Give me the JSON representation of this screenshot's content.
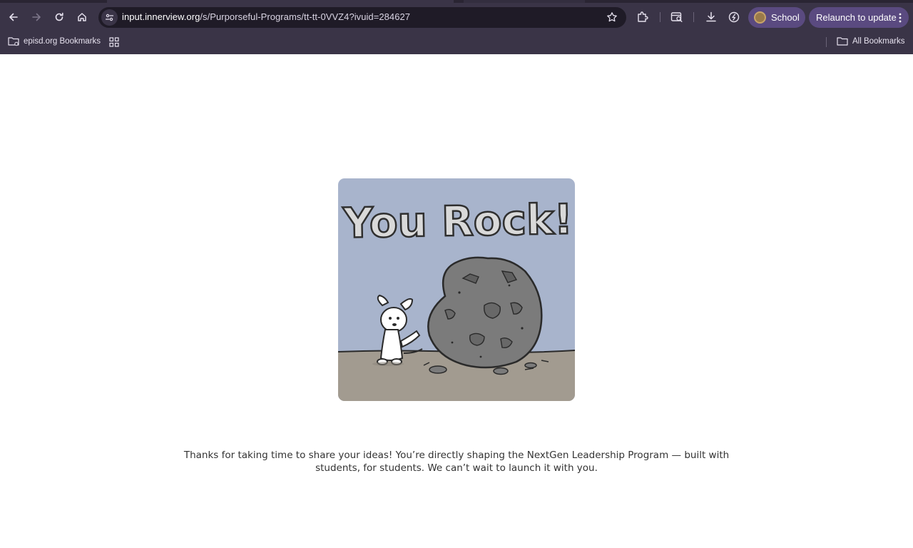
{
  "browser": {
    "url_host": "input.innerview.org",
    "url_path": "/s/Purporseful-Programs/tt-tt-0VVZ4?ivuid=284627",
    "profile_name": "School",
    "relaunch_label": "Relaunch to update"
  },
  "bookmarks": {
    "folder_label": "episd.org Bookmarks",
    "all_label": "All Bookmarks"
  },
  "page": {
    "image_title": "You Rock!",
    "message_line1": "Thanks for taking  time to share your ideas! You’re directly shaping the NextGen Leadership Program — built with",
    "message_line2": "students, for students. We can’t wait to launch it with you."
  },
  "colors": {
    "browser_chrome": "#3a3447",
    "omnibox": "#1f1b27",
    "pill": "#5a4a80",
    "illustration_sky": "#a8b4cc",
    "illustration_ground": "#a29b90",
    "rock": "#7b7b7b"
  },
  "icons": [
    "back-icon",
    "forward-icon",
    "reload-icon",
    "home-icon",
    "site-info-icon",
    "star-icon",
    "extensions-icon",
    "tab-search-icon",
    "download-icon",
    "performance-icon",
    "kebab-icon",
    "bookmark-folder-icon",
    "apps-grid-icon",
    "folder-icon"
  ]
}
